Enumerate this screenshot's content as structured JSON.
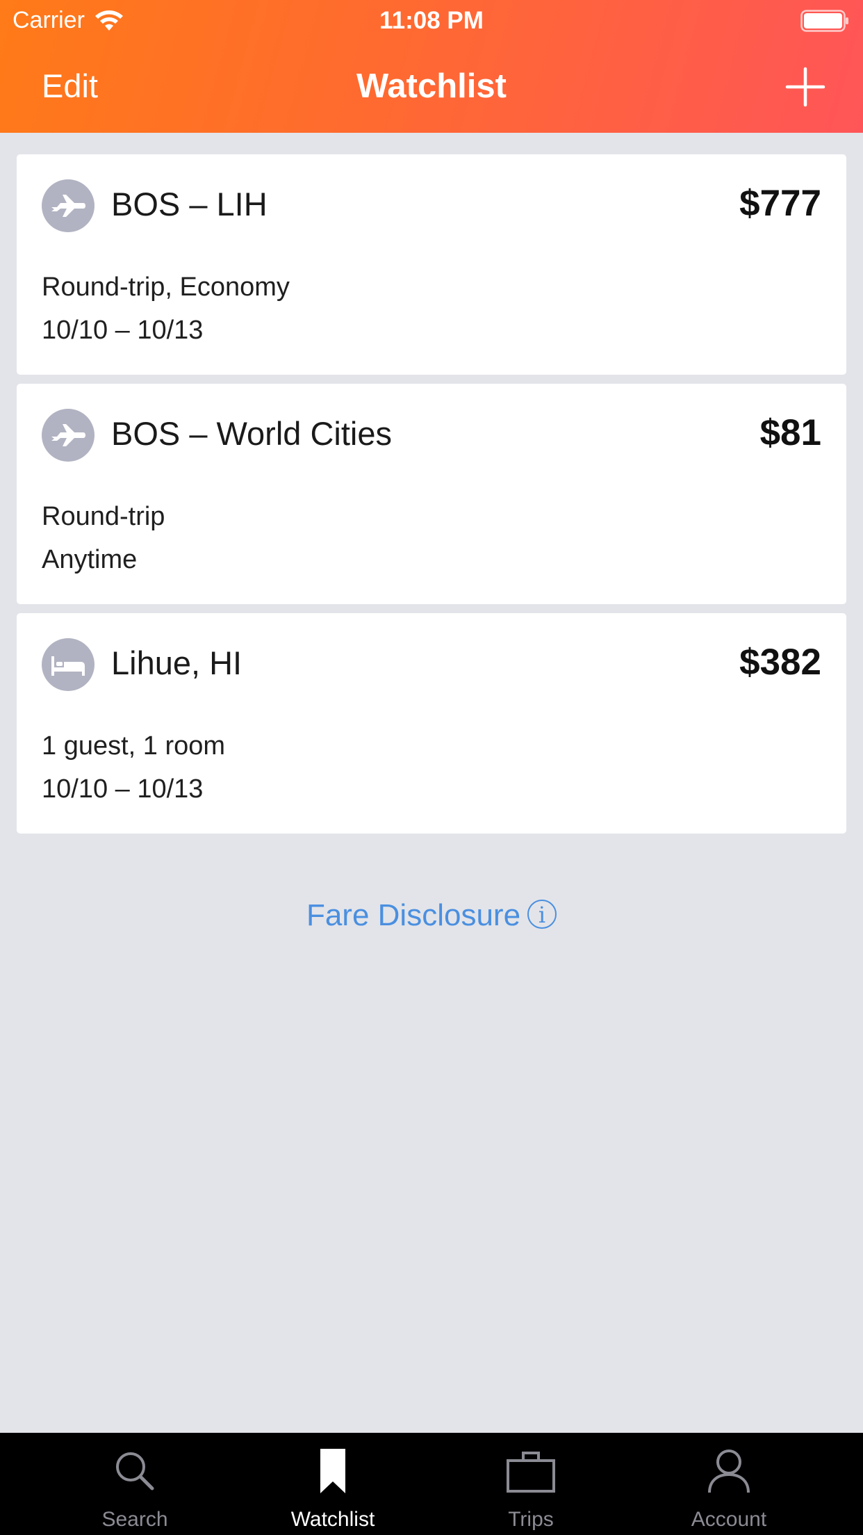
{
  "status_bar": {
    "carrier": "Carrier",
    "time": "11:08 PM"
  },
  "nav": {
    "edit_label": "Edit",
    "title": "Watchlist",
    "add_icon": "plus-icon"
  },
  "cards": [
    {
      "icon": "airplane-icon",
      "title": "BOS – LIH",
      "price": "$777",
      "line1": "Round-trip, Economy",
      "line2": "10/10 – 10/13"
    },
    {
      "icon": "airplane-icon",
      "title": "BOS – World Cities",
      "price": "$81",
      "line1": "Round-trip",
      "line2": "Anytime"
    },
    {
      "icon": "bed-icon",
      "title": "Lihue, HI",
      "price": "$382",
      "line1": "1 guest, 1 room",
      "line2": "10/10 – 10/13"
    }
  ],
  "fare_disclosure": {
    "label": "Fare Disclosure",
    "info_glyph": "i"
  },
  "tabs": [
    {
      "label": "Search",
      "icon": "search-icon",
      "active": false
    },
    {
      "label": "Watchlist",
      "icon": "bookmark-icon",
      "active": true
    },
    {
      "label": "Trips",
      "icon": "briefcase-icon",
      "active": false
    },
    {
      "label": "Account",
      "icon": "person-icon",
      "active": false
    }
  ],
  "colors": {
    "header_gradient_start": "#ff7a18",
    "header_gradient_end": "#ff5558",
    "background": "#e3e4e9",
    "link_blue": "#4a8fe0",
    "icon_circle": "#b1b3c2",
    "tab_inactive": "#8b8b94"
  }
}
